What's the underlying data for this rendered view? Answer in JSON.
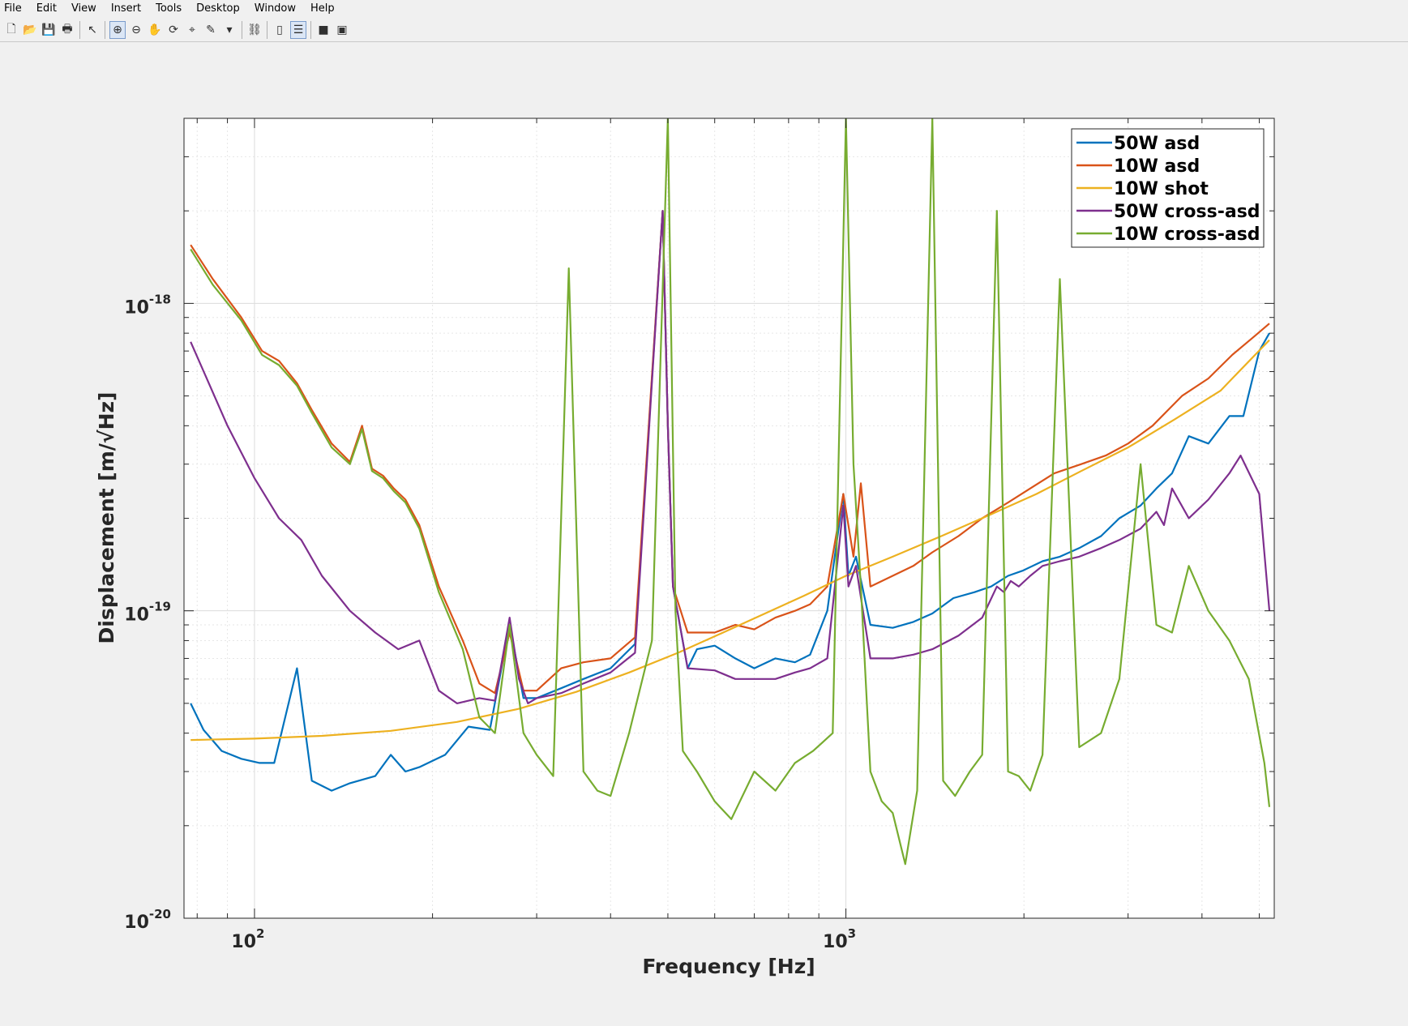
{
  "menu": [
    "File",
    "Edit",
    "View",
    "Insert",
    "Tools",
    "Desktop",
    "Window",
    "Help"
  ],
  "toolbar_icons": [
    {
      "name": "new-figure-icon",
      "glyph": "🗋"
    },
    {
      "name": "open-file-icon",
      "glyph": "📂"
    },
    {
      "name": "save-icon",
      "glyph": "💾"
    },
    {
      "name": "print-icon",
      "glyph": "🖶"
    },
    {
      "sep": true
    },
    {
      "name": "pointer-icon",
      "glyph": "↖"
    },
    {
      "sep": true
    },
    {
      "name": "zoom-in-icon",
      "glyph": "⊕",
      "active": true
    },
    {
      "name": "zoom-out-icon",
      "glyph": "⊖"
    },
    {
      "name": "pan-icon",
      "glyph": "✋"
    },
    {
      "name": "rotate-3d-icon",
      "glyph": "⟳"
    },
    {
      "name": "data-cursor-icon",
      "glyph": "⌖"
    },
    {
      "name": "brush-icon",
      "glyph": "✎"
    },
    {
      "name": "dropdown-arrow-icon",
      "glyph": "▾"
    },
    {
      "sep": true
    },
    {
      "name": "link-plot-icon",
      "glyph": "⛓"
    },
    {
      "sep": true
    },
    {
      "name": "colorbar-icon",
      "glyph": "▯"
    },
    {
      "name": "legend-icon",
      "glyph": "☰",
      "active": true
    },
    {
      "sep": true
    },
    {
      "name": "hide-plot-tools-icon",
      "glyph": "■"
    },
    {
      "name": "show-plot-tools-icon",
      "glyph": "▣"
    }
  ],
  "chart_data": {
    "type": "line",
    "title": "",
    "xlabel": "Frequency [Hz]",
    "ylabel": "Displacement [m/√Hz]",
    "xscale": "log",
    "yscale": "log",
    "xlim": [
      76,
      5300
    ],
    "ylim": [
      1e-20,
      4e-18
    ],
    "xticks": [
      {
        "base": "10",
        "exp": "2",
        "value": 100
      },
      {
        "base": "10",
        "exp": "3",
        "value": 1000
      }
    ],
    "yticks": [
      {
        "base": "10",
        "exp": "-20",
        "value": 1e-20
      },
      {
        "base": "10",
        "exp": "-19",
        "value": 1e-19
      },
      {
        "base": "10",
        "exp": "-18",
        "value": 1e-18
      }
    ],
    "grid": true,
    "legend_position": "top-right",
    "series": [
      {
        "name": "50W asd",
        "color": "#0072bd",
        "x": [
          78,
          82,
          88,
          95,
          102,
          108,
          118,
          125,
          135,
          145,
          160,
          170,
          180,
          190,
          210,
          230,
          250,
          270,
          285,
          300,
          330,
          360,
          400,
          440,
          490,
          500,
          510,
          540,
          560,
          600,
          650,
          700,
          760,
          820,
          870,
          930,
          990,
          1010,
          1040,
          1100,
          1200,
          1300,
          1400,
          1520,
          1650,
          1760,
          1880,
          1990,
          2150,
          2300,
          2480,
          2700,
          2900,
          3150,
          3350,
          3560,
          3800,
          4100,
          4450,
          4700,
          5000,
          5200
        ],
        "y": [
          5e-20,
          4.1e-20,
          3.5e-20,
          3.3e-20,
          3.2e-20,
          3.2e-20,
          6.5e-20,
          2.8e-20,
          2.6e-20,
          2.75e-20,
          2.9e-20,
          3.4e-20,
          3e-20,
          3.1e-20,
          3.4e-20,
          4.2e-20,
          4.1e-20,
          9e-20,
          5.2e-20,
          5.2e-20,
          5.6e-20,
          6e-20,
          6.5e-20,
          7.8e-20,
          2e-18,
          4e-19,
          1.2e-19,
          6.5e-20,
          7.5e-20,
          7.7e-20,
          7e-20,
          6.5e-20,
          7e-20,
          6.8e-20,
          7.2e-20,
          1e-19,
          2.4e-19,
          1.3e-19,
          1.5e-19,
          9e-20,
          8.8e-20,
          9.2e-20,
          9.8e-20,
          1.1e-19,
          1.15e-19,
          1.2e-19,
          1.3e-19,
          1.35e-19,
          1.45e-19,
          1.5e-19,
          1.6e-19,
          1.75e-19,
          2e-19,
          2.2e-19,
          2.5e-19,
          2.8e-19,
          3.7e-19,
          3.5e-19,
          4.3e-19,
          4.3e-19,
          7e-19,
          8e-19
        ]
      },
      {
        "name": "10W asd",
        "color": "#d95319",
        "x": [
          78,
          85,
          95,
          103,
          110,
          118,
          125,
          135,
          145,
          152,
          158,
          165,
          172,
          180,
          190,
          205,
          225,
          240,
          255,
          270,
          285,
          300,
          330,
          360,
          400,
          440,
          490,
          500,
          510,
          540,
          600,
          650,
          700,
          760,
          820,
          870,
          930,
          990,
          1030,
          1060,
          1100,
          1200,
          1300,
          1400,
          1550,
          1700,
          1880,
          2050,
          2250,
          2500,
          2750,
          3000,
          3300,
          3700,
          4100,
          4500,
          4900,
          5200
        ],
        "y": [
          1.55e-18,
          1.2e-18,
          9e-19,
          7e-19,
          6.5e-19,
          5.5e-19,
          4.5e-19,
          3.5e-19,
          3.05e-19,
          4e-19,
          2.9e-19,
          2.75e-19,
          2.5e-19,
          2.3e-19,
          1.9e-19,
          1.2e-19,
          8e-20,
          5.8e-20,
          5.4e-20,
          8.5e-20,
          5.5e-20,
          5.5e-20,
          6.5e-20,
          6.8e-20,
          7e-20,
          8.2e-20,
          2e-18,
          4e-19,
          1.2e-19,
          8.5e-20,
          8.5e-20,
          9e-20,
          8.7e-20,
          9.5e-20,
          1e-19,
          1.05e-19,
          1.2e-19,
          2.4e-19,
          1.5e-19,
          2.6e-19,
          1.2e-19,
          1.3e-19,
          1.4e-19,
          1.55e-19,
          1.75e-19,
          2e-19,
          2.25e-19,
          2.5e-19,
          2.8e-19,
          3e-19,
          3.2e-19,
          3.5e-19,
          4e-19,
          5e-19,
          5.7e-19,
          6.8e-19,
          7.8e-19,
          8.6e-19
        ]
      },
      {
        "name": "10W shot",
        "color": "#edb120",
        "x": [
          78,
          100,
          130,
          170,
          220,
          280,
          350,
          430,
          520,
          620,
          730,
          850,
          1000,
          1200,
          1450,
          1750,
          2100,
          2500,
          3000,
          3600,
          4300,
          5200
        ],
        "y": [
          3.8e-20,
          3.84e-20,
          3.92e-20,
          4.07e-20,
          4.35e-20,
          4.8e-20,
          5.45e-20,
          6.3e-20,
          7.3e-20,
          8.5e-20,
          9.8e-20,
          1.12e-19,
          1.3e-19,
          1.5e-19,
          1.75e-19,
          2.05e-19,
          2.4e-19,
          2.85e-19,
          3.4e-19,
          4.2e-19,
          5.2e-19,
          7.6e-19
        ]
      },
      {
        "name": "50W cross-asd",
        "color": "#7e2f8e",
        "x": [
          78,
          90,
          100,
          110,
          120,
          130,
          145,
          160,
          175,
          190,
          205,
          220,
          240,
          255,
          270,
          280,
          290,
          300,
          330,
          360,
          400,
          440,
          490,
          500,
          510,
          540,
          600,
          650,
          700,
          760,
          820,
          870,
          930,
          990,
          1010,
          1040,
          1100,
          1200,
          1300,
          1400,
          1550,
          1700,
          1800,
          1850,
          1900,
          1960,
          2050,
          2150,
          2300,
          2480,
          2700,
          2900,
          3150,
          3350,
          3450,
          3560,
          3800,
          4100,
          4450,
          4650,
          5000,
          5200
        ],
        "y": [
          7.5e-19,
          4e-19,
          2.7e-19,
          2e-19,
          1.7e-19,
          1.3e-19,
          1e-19,
          8.5e-20,
          7.5e-20,
          8e-20,
          5.5e-20,
          5e-20,
          5.2e-20,
          5.1e-20,
          9.5e-20,
          6e-20,
          5e-20,
          5.2e-20,
          5.4e-20,
          5.8e-20,
          6.3e-20,
          7.3e-20,
          2e-18,
          4e-19,
          1.2e-19,
          6.5e-20,
          6.4e-20,
          6e-20,
          6e-20,
          6e-20,
          6.3e-20,
          6.5e-20,
          7e-20,
          2.2e-19,
          1.2e-19,
          1.4e-19,
          7e-20,
          7e-20,
          7.2e-20,
          7.5e-20,
          8.3e-20,
          9.5e-20,
          1.2e-19,
          1.15e-19,
          1.25e-19,
          1.2e-19,
          1.3e-19,
          1.4e-19,
          1.45e-19,
          1.5e-19,
          1.6e-19,
          1.7e-19,
          1.85e-19,
          2.1e-19,
          1.9e-19,
          2.5e-19,
          2e-19,
          2.3e-19,
          2.8e-19,
          3.2e-19,
          2.4e-19,
          1e-19
        ]
      },
      {
        "name": "10W cross-asd",
        "color": "#77ac30",
        "x": [
          78,
          85,
          95,
          103,
          110,
          118,
          125,
          135,
          145,
          152,
          158,
          165,
          172,
          180,
          190,
          205,
          225,
          240,
          255,
          270,
          285,
          300,
          320,
          340,
          360,
          380,
          400,
          430,
          470,
          500,
          515,
          530,
          560,
          600,
          640,
          700,
          760,
          820,
          880,
          950,
          1000,
          1030,
          1060,
          1100,
          1150,
          1200,
          1260,
          1320,
          1400,
          1460,
          1530,
          1620,
          1700,
          1800,
          1880,
          1960,
          2050,
          2150,
          2300,
          2480,
          2700,
          2900,
          3150,
          3350,
          3560,
          3800,
          4100,
          4450,
          4800,
          5100,
          5200
        ],
        "y": [
          1.5e-18,
          1.15e-18,
          8.8e-19,
          6.8e-19,
          6.3e-19,
          5.4e-19,
          4.4e-19,
          3.4e-19,
          3e-19,
          3.9e-19,
          2.85e-19,
          2.7e-19,
          2.45e-19,
          2.25e-19,
          1.85e-19,
          1.15e-19,
          7.5e-20,
          4.5e-20,
          4e-20,
          9e-20,
          4e-20,
          3.4e-20,
          2.9e-20,
          1.3e-18,
          3e-20,
          2.6e-20,
          2.5e-20,
          4e-20,
          8e-20,
          4e-18,
          1e-19,
          3.5e-20,
          3e-20,
          2.4e-20,
          2.1e-20,
          3e-20,
          2.6e-20,
          3.2e-20,
          3.5e-20,
          4e-20,
          4e-18,
          3e-19,
          1.2e-19,
          3e-20,
          2.4e-20,
          2.2e-20,
          1.5e-20,
          2.6e-20,
          4e-18,
          2.8e-20,
          2.5e-20,
          3e-20,
          3.4e-20,
          2e-18,
          3e-20,
          2.9e-20,
          2.6e-20,
          3.4e-20,
          1.2e-18,
          3.6e-20,
          4e-20,
          6e-20,
          3e-19,
          9e-20,
          8.5e-20,
          1.4e-19,
          1e-19,
          8e-20,
          6e-20,
          3.2e-20,
          2.3e-20
        ]
      }
    ]
  }
}
